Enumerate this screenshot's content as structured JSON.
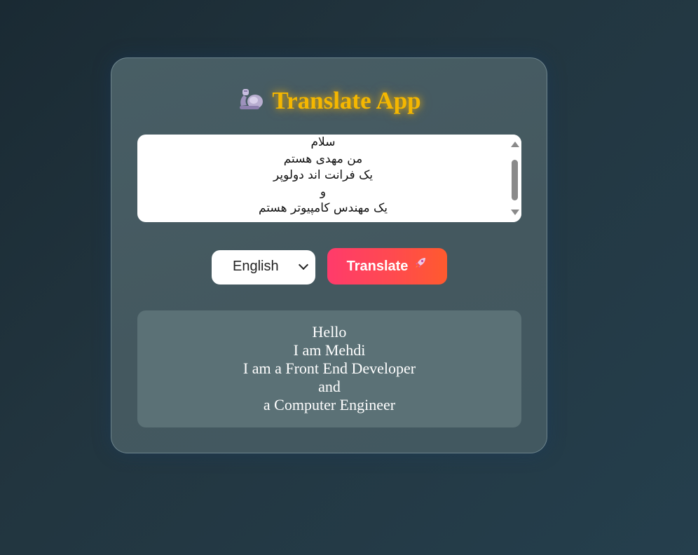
{
  "app": {
    "title": "Translate App",
    "title_icon": "flexed-arm-icon"
  },
  "source": {
    "lines": [
      "سلام",
      "من مهدی هستم",
      "یک فرانت اند دولوپر",
      "و",
      "یک مهندس کامپیوتر هستم"
    ]
  },
  "controls": {
    "language_selected": "English",
    "translate_label": "Translate",
    "translate_icon": "rocket-icon"
  },
  "result": {
    "lines": [
      "Hello",
      "I am Mehdi",
      "I am a Front End Developer",
      "and",
      "a Computer Engineer"
    ]
  },
  "colors": {
    "title": "#f5b700",
    "button_start": "#ff3b6b",
    "button_end": "#ff5a2e",
    "card": "#485e65",
    "result_box": "#5b7176"
  }
}
